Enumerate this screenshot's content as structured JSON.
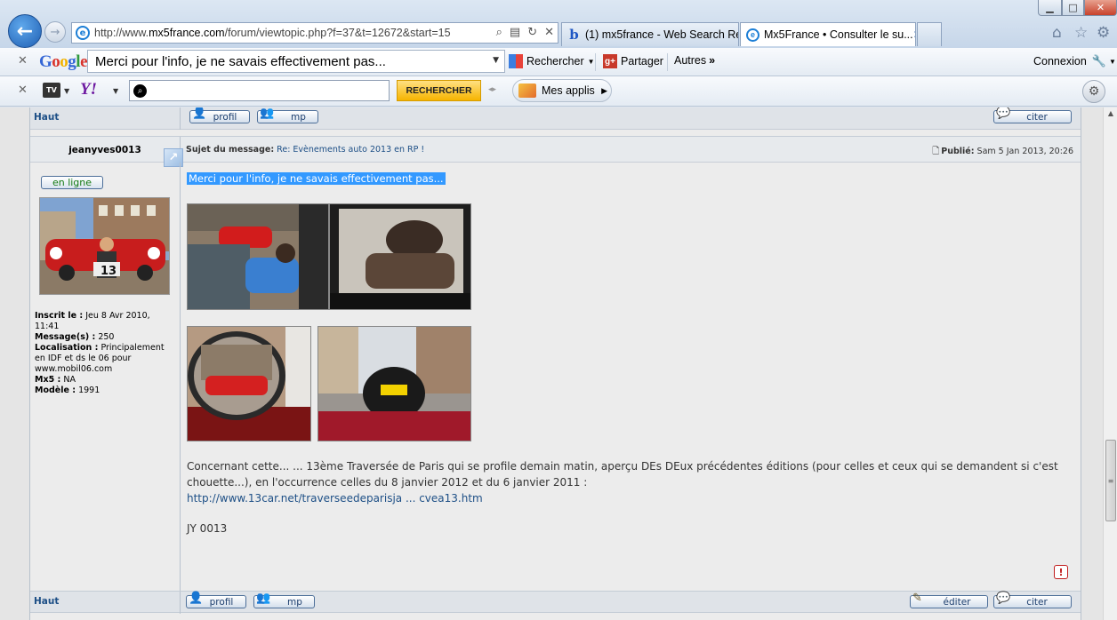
{
  "browser": {
    "url_prefix": "http://www.",
    "url_host": "mx5france.com",
    "url_path": "/forum/viewtopic.php?f=37&t=12672&start=15",
    "tabs": [
      {
        "label": "(1) mx5france - Web Search Re..."
      },
      {
        "label": "Mx5France • Consulter le su..."
      }
    ],
    "window_controls": {
      "minimize": "▁",
      "maximize": "□",
      "close": "✕"
    }
  },
  "google_toolbar": {
    "logo": "Google",
    "search_value": "Merci pour l'info, je ne savais effectivement pas...",
    "search_button": "Rechercher",
    "share_button": "Partager",
    "more_button": "Autres",
    "more_arrows": "»",
    "connect_button": "Connexion"
  },
  "yahoo_toolbar": {
    "tv_label": "TV",
    "logo": "Y!",
    "search_value": "",
    "search_button": "RECHERCHER",
    "apps_button": "Mes applis"
  },
  "post": {
    "top_haut": "Haut",
    "top_buttons": {
      "profile": "profil",
      "pm": "mp",
      "quote": "citer"
    },
    "author": "jeanyves0013",
    "subject_label": "Sujet du message:",
    "subject_value": "Re: Evènements auto 2013 en RP !",
    "posted_label": "Publié:",
    "posted_value": "Sam 5 Jan 2013, 20:26",
    "online_badge": "en ligne",
    "profile": {
      "joined_label": "Inscrit le :",
      "joined_value": "Jeu 8 Avr 2010, 11:41",
      "messages_label": "Message(s) :",
      "messages_value": "250",
      "location_label": "Localisation :",
      "location_value": "Principalement en IDF et ds le 06 pour www.mobil06.com",
      "mx5_label": "Mx5 :",
      "mx5_value": "NA",
      "model_label": "Modèle :",
      "model_value": "1991"
    },
    "selected_text": "Merci pour l'info, je ne savais effectivement pas...",
    "body_text": "Concernant cette... ... 13ème Traversée de Paris qui se profile demain matin, aperçu DEs DEux précédentes éditions (pour celles et ceux qui se demandent si c'est chouette...), en l'occurrence celles du 8 janvier 2012 et du 6 janvier 2011 :",
    "body_link": "http://www.13car.net/traverseedeparisja ... cvea13.htm",
    "signature": "JY 0013",
    "bottom_haut": "Haut",
    "bottom_buttons": {
      "profile": "profil",
      "pm": "mp",
      "edit": "éditer",
      "quote": "citer"
    }
  },
  "colors": {
    "selection": "#3399ff",
    "link": "#1d4f86",
    "online": "#137a13",
    "report": "#c01b1b"
  }
}
